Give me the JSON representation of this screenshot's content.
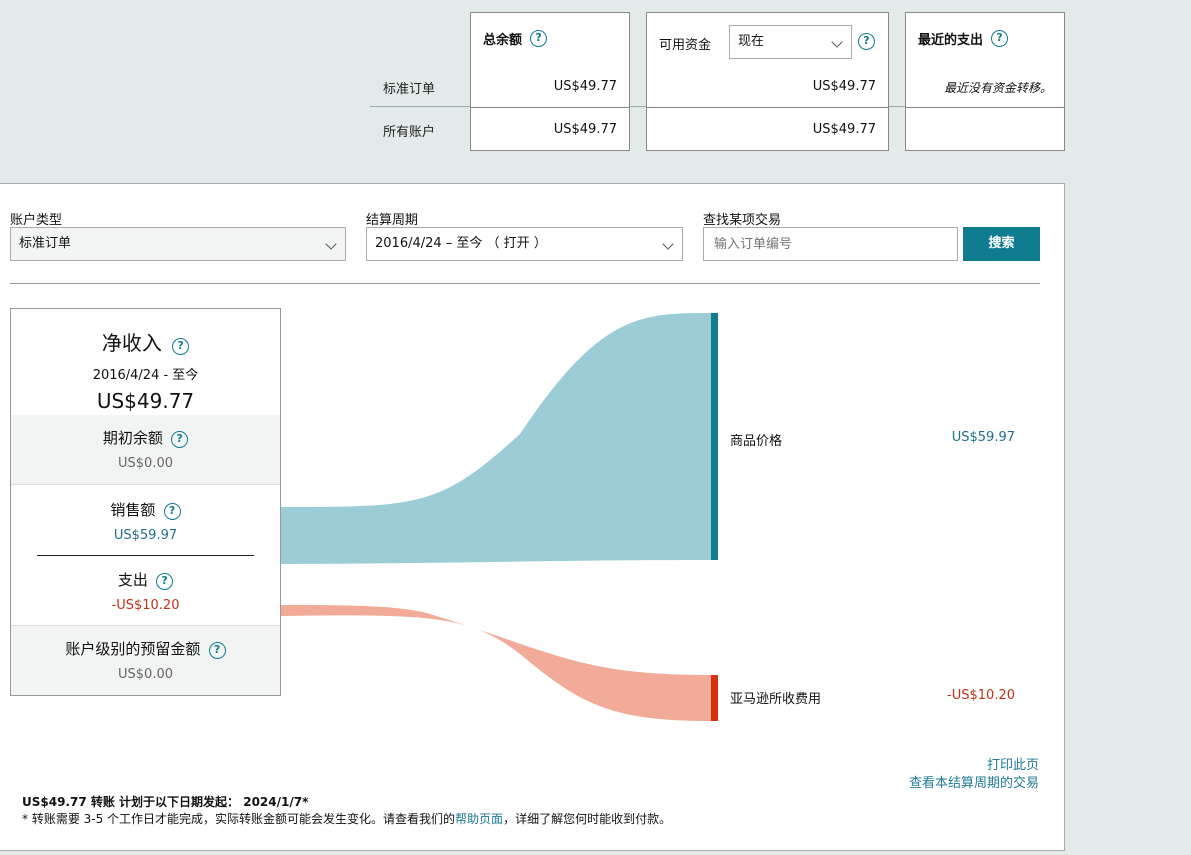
{
  "summary": {
    "rows": [
      "标准订单",
      "所有账户"
    ],
    "total": {
      "title": "总余额",
      "values": [
        "US$49.77",
        "US$49.77"
      ]
    },
    "available": {
      "title": "可用资金",
      "select": "现在",
      "values": [
        "US$49.77",
        "US$49.77"
      ]
    },
    "recent": {
      "title": "最近的支出",
      "message": "最近没有资金转移。"
    }
  },
  "filters": {
    "account_type": {
      "label": "账户类型",
      "value": "标准订单"
    },
    "period": {
      "label": "结算周期",
      "value": "2016/4/24 – 至今 （ 打开 ）"
    },
    "search": {
      "label": "查找某项交易",
      "placeholder": "输入订单编号",
      "button": "搜索"
    }
  },
  "net": {
    "title": "净收入",
    "range": "2016/4/24 - 至今",
    "amount": "US$49.77",
    "opening": {
      "label": "期初余额",
      "value": "US$0.00"
    },
    "sales": {
      "label": "销售额",
      "value": "US$59.97"
    },
    "expenses": {
      "label": "支出",
      "value": "-US$10.20"
    },
    "reserve": {
      "label": "账户级别的预留金额",
      "value": "US$0.00"
    }
  },
  "flows": {
    "product": {
      "label": "商品价格",
      "value": "US$59.97",
      "color": "#9ccdd6",
      "bar": "#0f7c90"
    },
    "fees": {
      "label": "亚马逊所收费用",
      "value": "-US$10.20",
      "color": "#f1ab98",
      "bar": "#d9310f"
    }
  },
  "links": {
    "print": "打印此页",
    "view": "查看本结算周期的交易"
  },
  "footer": {
    "transfer": "US$49.77 转账 计划于以下日期发起： 2024/1/7*",
    "note_before": "* 转账需要 3-5 个工作日才能完成，实际转账金额可能会发生变化。请查看我们的",
    "note_link": "帮助页面",
    "note_after": "，详细了解您何时能收到付款。"
  }
}
